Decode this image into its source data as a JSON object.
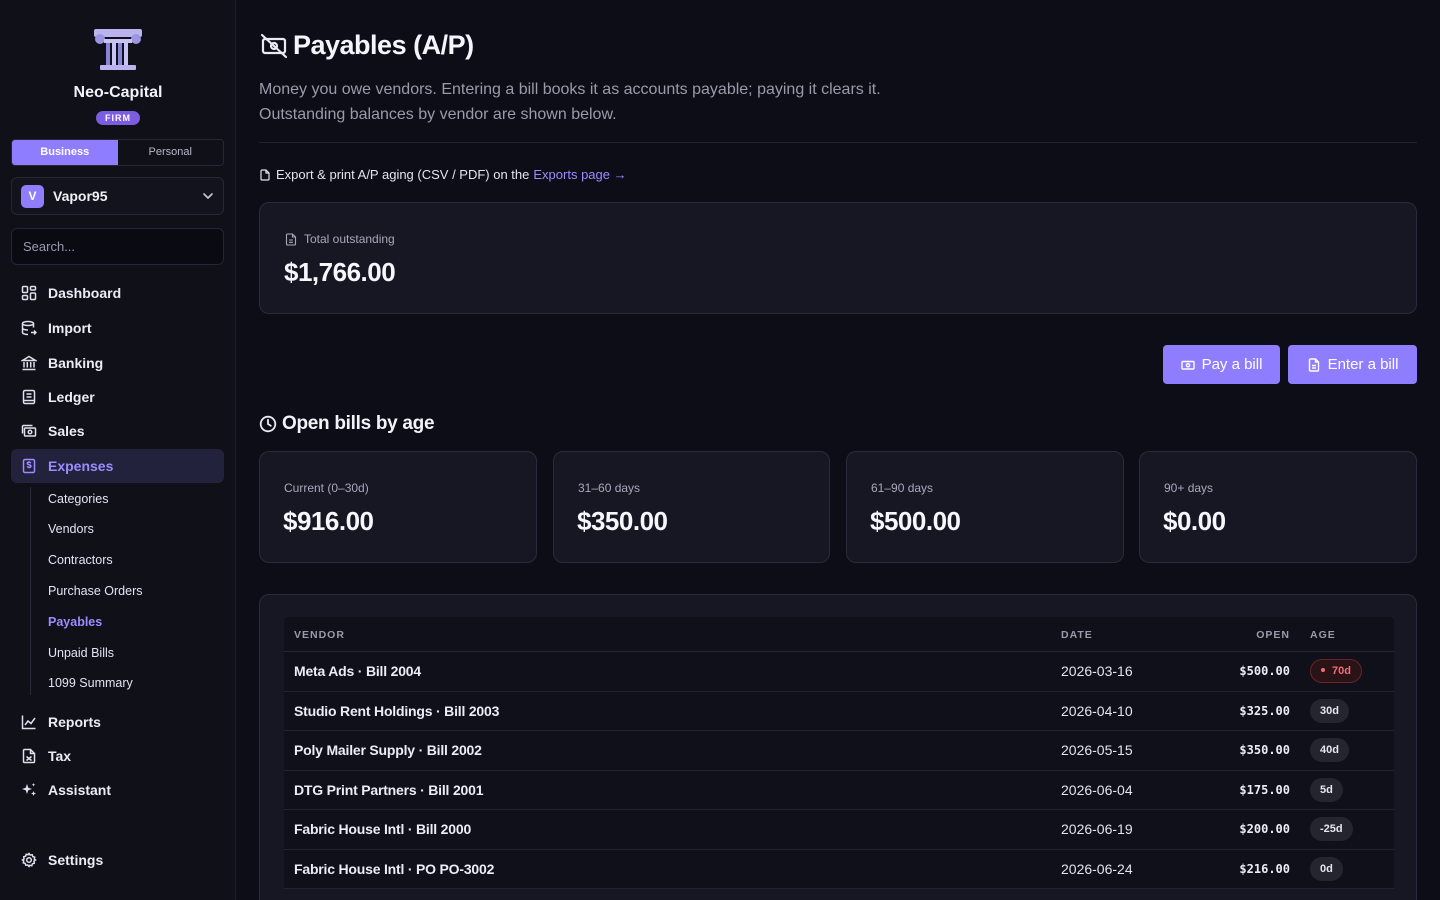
{
  "brand": {
    "name": "Neo-Capital",
    "badge": "FIRM"
  },
  "mode": {
    "business": "Business",
    "personal": "Personal"
  },
  "workspace": {
    "initial": "V",
    "name": "Vapor95"
  },
  "search": {
    "placeholder": "Search..."
  },
  "nav": {
    "dashboard": "Dashboard",
    "import": "Import",
    "banking": "Banking",
    "ledger": "Ledger",
    "sales": "Sales",
    "expenses": "Expenses",
    "reports": "Reports",
    "tax": "Tax",
    "assistant": "Assistant",
    "settings": "Settings"
  },
  "expenses_sub": [
    {
      "label": "Categories"
    },
    {
      "label": "Vendors"
    },
    {
      "label": "Contractors"
    },
    {
      "label": "Purchase Orders"
    },
    {
      "label": "Payables"
    },
    {
      "label": "Unpaid Bills"
    },
    {
      "label": "1099 Summary"
    }
  ],
  "page": {
    "title": "Payables (A/P)",
    "desc_line1": "Money you owe vendors. Entering a bill books it as accounts payable; paying it clears it.",
    "desc_line2": "Outstanding balances by vendor are shown below.",
    "export_text": "Export & print A/P aging (CSV / PDF) on the",
    "export_link": "Exports page →"
  },
  "total": {
    "label": "Total outstanding",
    "value": "$1,766.00"
  },
  "actions": {
    "pay": "Pay a bill",
    "enter": "Enter a bill"
  },
  "aging": {
    "title": "Open bills by age",
    "buckets": [
      {
        "label": "Current (0–30d)",
        "value": "$916.00"
      },
      {
        "label": "31–60 days",
        "value": "$350.00"
      },
      {
        "label": "61–90 days",
        "value": "$500.00"
      },
      {
        "label": "90+ days",
        "value": "$0.00"
      }
    ]
  },
  "table": {
    "headers": {
      "vendor": "VENDOR",
      "date": "DATE",
      "open": "OPEN",
      "age": "AGE"
    },
    "rows": [
      {
        "vendor": "Meta Ads · Bill 2004",
        "date": "2026-03-16",
        "open": "$500.00",
        "age": "70d",
        "overdue": true
      },
      {
        "vendor": "Studio Rent Holdings · Bill 2003",
        "date": "2026-04-10",
        "open": "$325.00",
        "age": "30d",
        "overdue": false
      },
      {
        "vendor": "Poly Mailer Supply · Bill 2002",
        "date": "2026-05-15",
        "open": "$350.00",
        "age": "40d",
        "overdue": false
      },
      {
        "vendor": "DTG Print Partners · Bill 2001",
        "date": "2026-06-04",
        "open": "$175.00",
        "age": "5d",
        "overdue": false
      },
      {
        "vendor": "Fabric House Intl · Bill 2000",
        "date": "2026-06-19",
        "open": "$200.00",
        "age": "-25d",
        "overdue": false
      },
      {
        "vendor": "Fabric House Intl · PO PO-3002",
        "date": "2026-06-24",
        "open": "$216.00",
        "age": "0d",
        "overdue": false
      }
    ]
  },
  "colors": {
    "accent": "#8f7dff",
    "bg": "#0d0d17",
    "card": "#171724",
    "alert": "#f36d75"
  }
}
